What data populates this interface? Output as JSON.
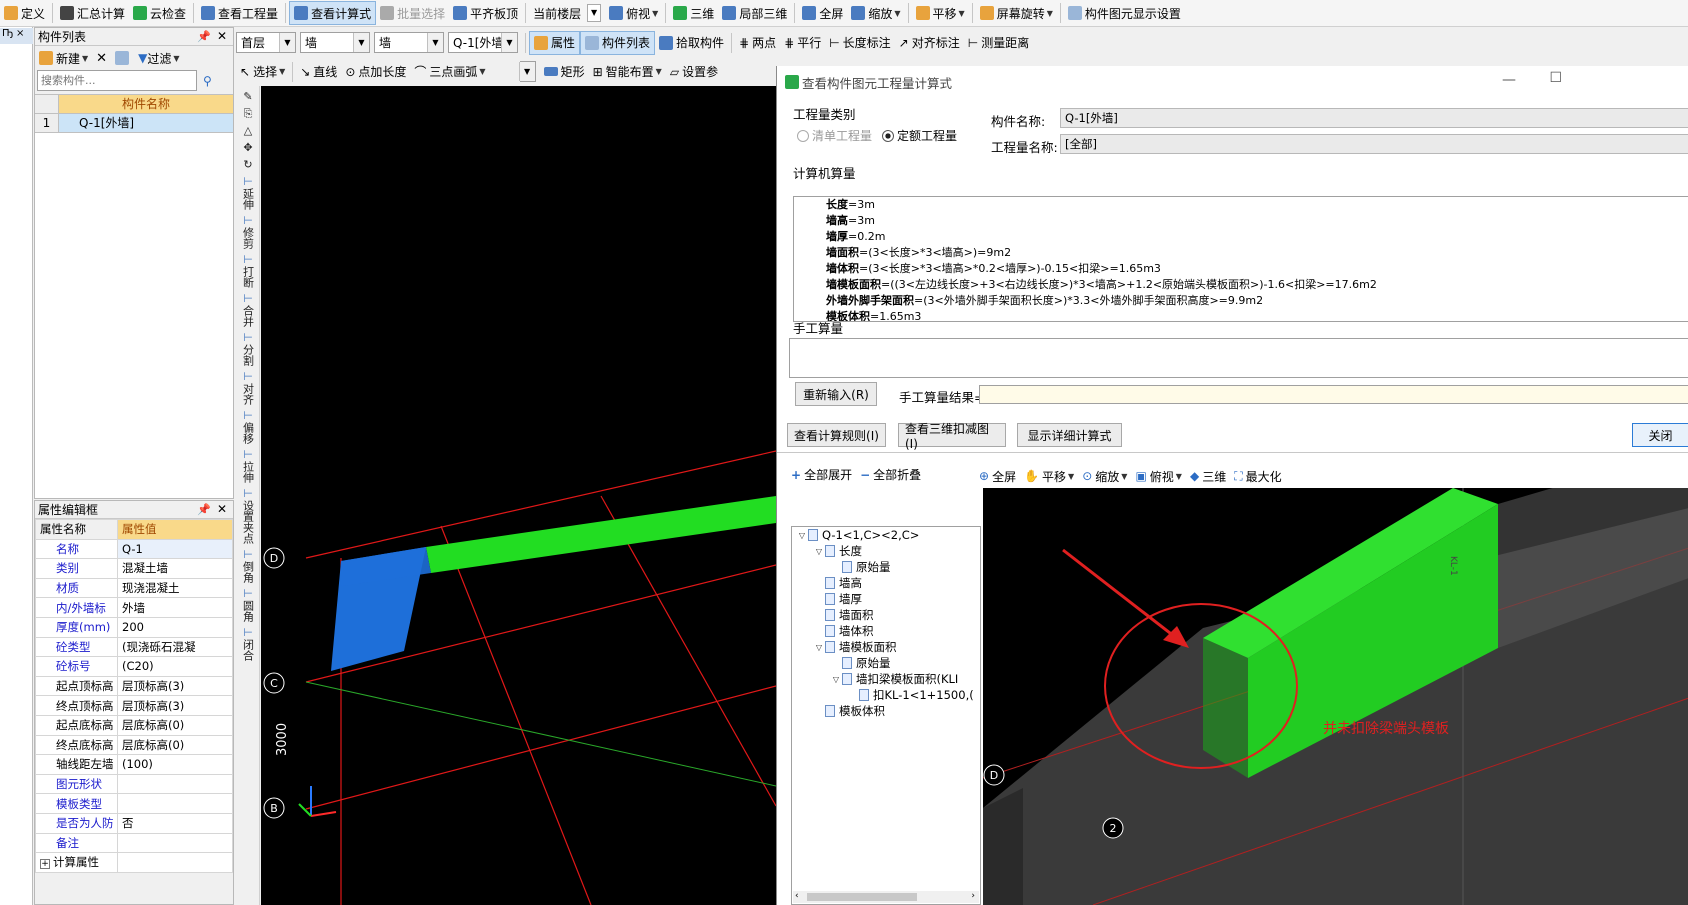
{
  "toolbar": {
    "items": [
      {
        "label": "定义"
      },
      {
        "label": "汇总计算"
      },
      {
        "label": "云检查"
      },
      {
        "label": "查看工程量"
      },
      {
        "label": "查看计算式",
        "active": true
      },
      {
        "label": "批量选择",
        "disabled": true
      },
      {
        "label": "平齐板顶"
      },
      {
        "label": "当前楼层"
      },
      {
        "label": "俯视"
      },
      {
        "label": "三维"
      },
      {
        "label": "局部三维"
      },
      {
        "label": "全屏"
      },
      {
        "label": "缩放"
      },
      {
        "label": "平移"
      },
      {
        "label": "屏幕旋转"
      },
      {
        "label": "构件图元显示设置"
      }
    ]
  },
  "row2": {
    "floor": "首层",
    "type1": "墙",
    "type2": "墙",
    "comp": "Q-1[外墙",
    "btn_attr": "属性",
    "btn_list": "构件列表",
    "btn_pick": "拾取构件",
    "btn_two": "两点",
    "btn_par": "平行",
    "btn_len": "长度标注",
    "btn_align": "对齐标注",
    "btn_measure": "测量距离"
  },
  "row3": {
    "select": "选择",
    "line": "直线",
    "point_len": "点加长度",
    "arc": "三点画弧",
    "rect": "矩形",
    "smart": "智能布置",
    "set": "设置参"
  },
  "comp_panel": {
    "title": "构件列表",
    "new": "新建",
    "filter": "过滤",
    "search_placeholder": "搜索构件...",
    "col_header": "构件名称",
    "rows": [
      {
        "idx": "1",
        "name": "Q-1[外墙]"
      }
    ]
  },
  "prop_panel": {
    "title": "属性编辑框",
    "col_name": "属性名称",
    "col_value": "属性值",
    "rows": [
      {
        "k": "名称",
        "v": "Q-1",
        "blue": true
      },
      {
        "k": "类别",
        "v": "混凝土墙",
        "blue": true
      },
      {
        "k": "材质",
        "v": "现浇混凝土",
        "blue": true
      },
      {
        "k": "内/外墙标",
        "v": "外墙",
        "blue": true
      },
      {
        "k": "厚度(mm)",
        "v": "200",
        "blue": true
      },
      {
        "k": "砼类型",
        "v": "(现浇砾石混凝",
        "blue": true
      },
      {
        "k": "砼标号",
        "v": "(C20)",
        "blue": true
      },
      {
        "k": "起点顶标高",
        "v": "层顶标高(3)",
        "blue": false
      },
      {
        "k": "终点顶标高",
        "v": "层顶标高(3)",
        "blue": false
      },
      {
        "k": "起点底标高",
        "v": "层底标高(0)",
        "blue": false
      },
      {
        "k": "终点底标高",
        "v": "层底标高(0)",
        "blue": false
      },
      {
        "k": "轴线距左墙",
        "v": "(100)",
        "blue": false
      },
      {
        "k": "图元形状",
        "v": "",
        "blue": true
      },
      {
        "k": "模板类型",
        "v": "",
        "blue": true
      },
      {
        "k": "是否为人防",
        "v": "否",
        "blue": true
      },
      {
        "k": "备注",
        "v": "",
        "blue": true
      },
      {
        "k": "计算属性",
        "v": "",
        "blue": false
      }
    ]
  },
  "vtools": [
    "延伸",
    "修剪",
    "打断",
    "合并",
    "分割",
    "对齐",
    "偏移",
    "拉伸",
    "设置夹点",
    "倒角",
    "圆角",
    "闭合"
  ],
  "canvas": {
    "axis_labels": [
      "D",
      "C",
      "B"
    ],
    "dim": "3000"
  },
  "dialog": {
    "title": "查看构件图元工程量计算式",
    "qty_type_label": "工程量类别",
    "opt1": "清单工程量",
    "opt2": "定额工程量",
    "comp_name_label": "构件名称:",
    "comp_name": "Q-1[外墙]",
    "qty_name_label": "工程量名称:",
    "qty_name": "[全部]",
    "calc_label": "计算机算量",
    "formulas": [
      {
        "k": "长度",
        "v": "=3m"
      },
      {
        "k": "墙高",
        "v": "=3m"
      },
      {
        "k": "墙厚",
        "v": "=0.2m"
      },
      {
        "k": "墙面积",
        "v": "=(3<长度>*3<墙高>)=9m2"
      },
      {
        "k": "墙体积",
        "v": "=(3<长度>*3<墙高>*0.2<墙厚>)-0.15<扣梁>=1.65m3"
      },
      {
        "k": "墙模板面积",
        "v": "=((3<左边线长度>+3<右边线长度>)*3<墙高>+1.2<原始端头模板面积>)-1.6<扣梁>=17.6m2"
      },
      {
        "k": "外墙外脚手架面积",
        "v": "=(3<外墙外脚手架面积长度>)*3.3<外墙外脚手架面积高度>=9.9m2"
      },
      {
        "k": "模板体积",
        "v": "=1.65m3"
      }
    ],
    "manual_label": "手工算量",
    "reinput": "重新输入(R)",
    "manual_result": "手工算量结果=",
    "btn_rule": "查看计算规则(I)",
    "btn_3d": "查看三维扣减图(I)",
    "btn_detail": "显示详细计算式",
    "btn_close": "关闭",
    "expand_all": "全部展开",
    "collapse_all": "全部折叠",
    "tree": [
      {
        "t": "Q-1<1,C><2,C>",
        "lv": 0,
        "tg": "▽"
      },
      {
        "t": "长度",
        "lv": 1,
        "tg": "▽"
      },
      {
        "t": "原始量",
        "lv": 2,
        "tg": ""
      },
      {
        "t": "墙高",
        "lv": 1,
        "tg": ""
      },
      {
        "t": "墙厚",
        "lv": 1,
        "tg": ""
      },
      {
        "t": "墙面积",
        "lv": 1,
        "tg": ""
      },
      {
        "t": "墙体积",
        "lv": 1,
        "tg": ""
      },
      {
        "t": "墙模板面积",
        "lv": 1,
        "tg": "▽"
      },
      {
        "t": "原始量",
        "lv": 2,
        "tg": ""
      },
      {
        "t": "墙扣梁模板面积(KLI",
        "lv": 2,
        "tg": "▽"
      },
      {
        "t": "扣KL-1<1+1500,(",
        "lv": 3,
        "tg": ""
      },
      {
        "t": "模板体积",
        "lv": 1,
        "tg": ""
      }
    ],
    "view_tb": [
      {
        "label": "全屏"
      },
      {
        "label": "平移"
      },
      {
        "label": "缩放"
      },
      {
        "label": "俯视"
      },
      {
        "label": "三维"
      },
      {
        "label": "最大化"
      }
    ],
    "annotation": "并未扣除梁端头模板",
    "view_axis": [
      "D",
      "2"
    ],
    "beam_label": "KL-1"
  },
  "colors": {
    "green": "#22dd22",
    "blue": "#1e6fd9",
    "red": "#e02020",
    "canvas": "#000000"
  }
}
